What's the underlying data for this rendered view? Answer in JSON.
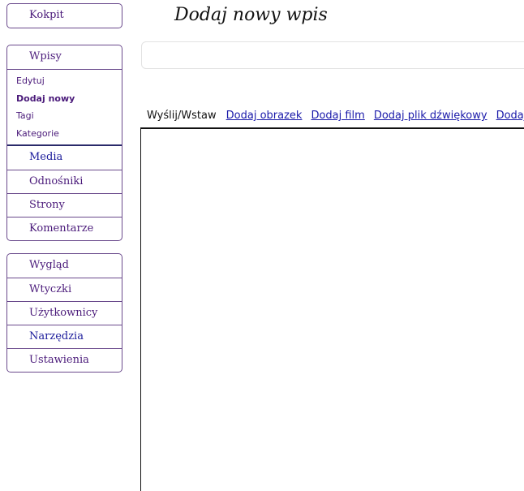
{
  "page_title": "Dodaj nowy wpis",
  "title_input": {
    "value": "",
    "placeholder": ""
  },
  "sidebar": {
    "dashboard": "Kokpit",
    "posts": {
      "label": "Wpisy",
      "submenu": [
        "Edytuj",
        "Dodaj nowy",
        "Tagi",
        "Kategorie"
      ],
      "current": "Dodaj nowy"
    },
    "group1": [
      "Media",
      "Odnośniki",
      "Strony",
      "Komentarze"
    ],
    "group2": [
      "Wygląd",
      "Wtyczki",
      "Użytkownicy",
      "Narzędzia",
      "Ustawienia"
    ]
  },
  "tabs": {
    "active": "Wyślij/Wstaw",
    "links": [
      "Dodaj obrazek",
      "Dodaj film",
      "Dodaj plik dźwiękowy",
      "Dodaj"
    ]
  }
}
